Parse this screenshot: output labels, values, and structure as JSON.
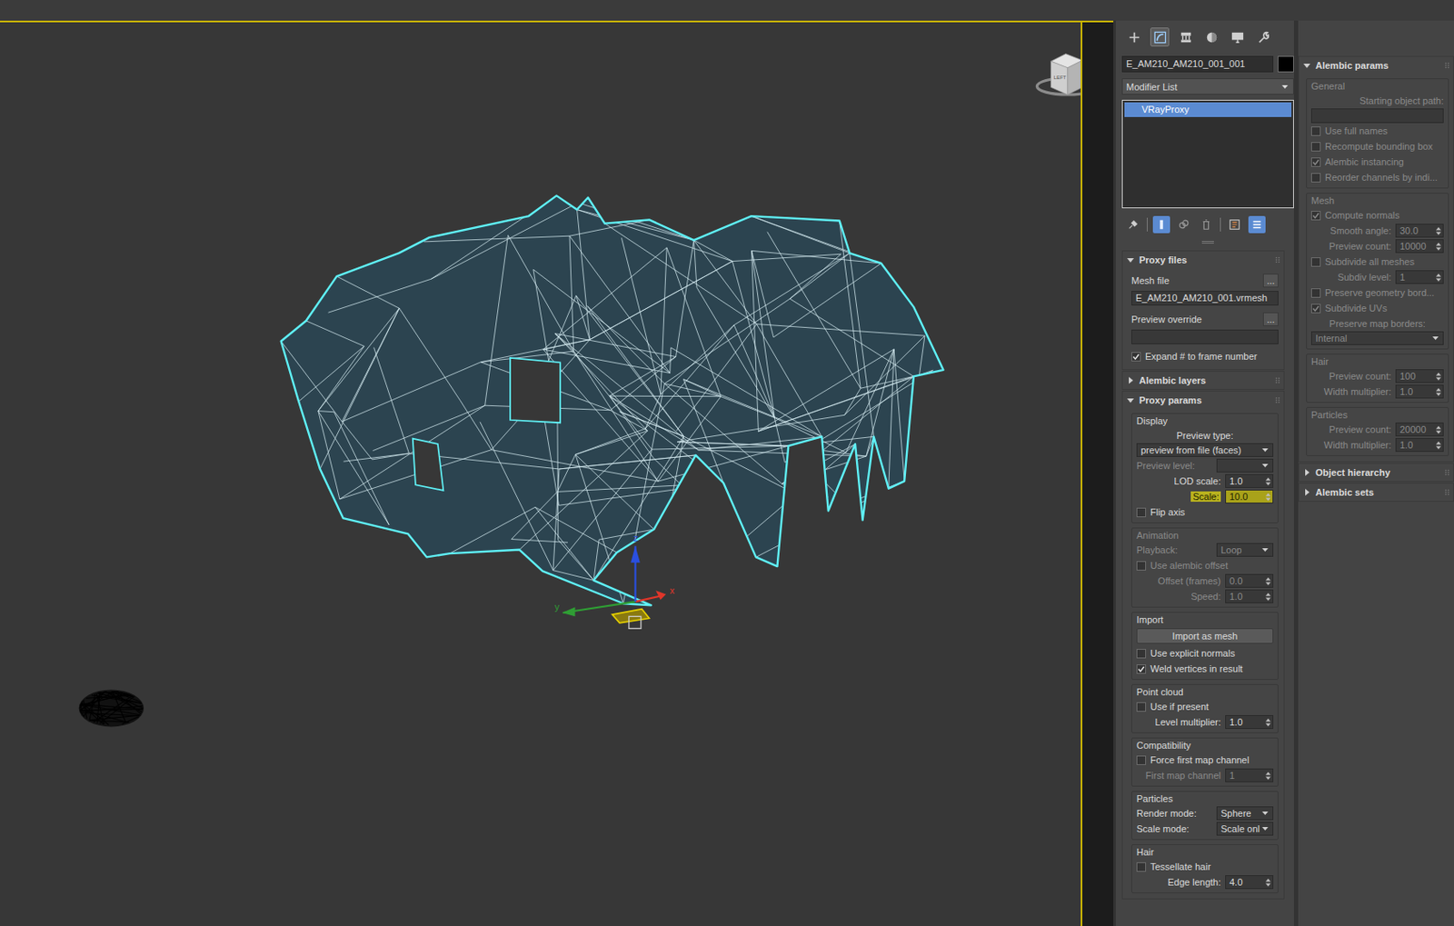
{
  "viewport": {
    "viewcube_label": "LEFT",
    "axes": [
      {
        "label": "x",
        "color": "#e0362a"
      },
      {
        "label": "y",
        "color": "#2f9e34"
      },
      {
        "label": "z",
        "color": "#2a4fe0"
      }
    ]
  },
  "command_tabs": [
    {
      "kind": "create",
      "selected": false
    },
    {
      "kind": "modify",
      "selected": true
    },
    {
      "kind": "hierarchy",
      "selected": false
    },
    {
      "kind": "motion",
      "selected": false
    },
    {
      "kind": "display",
      "selected": false
    },
    {
      "kind": "utilities",
      "selected": false
    }
  ],
  "object_name": "E_AM210_AM210_001_001",
  "modifier_list": "Modifier List",
  "stack": [
    {
      "label": "VRayProxy",
      "selected": true
    }
  ],
  "stack_tools": [
    {
      "kind": "pin",
      "selected": false
    },
    {
      "kind": "show-end-result",
      "selected": true
    },
    {
      "kind": "make-unique",
      "selected": false
    },
    {
      "kind": "remove",
      "selected": false
    },
    {
      "kind": "configure",
      "selected": false
    },
    {
      "kind": "sets",
      "selected": true
    }
  ],
  "rollouts": [
    {
      "title": "Proxy files",
      "expanded": true,
      "groups": [
        {
          "title": "",
          "boxed": false,
          "disabled": false,
          "items": [
            {
              "kind": "file",
              "label": "Mesh file",
              "button": "...",
              "value": "E_AM210_AM210_001.vrmesh"
            },
            {
              "kind": "file",
              "label": "Preview override",
              "button": "...",
              "value": ""
            },
            {
              "kind": "checkbox",
              "label": "Expand # to frame number",
              "checked": true,
              "disabled": false
            }
          ]
        }
      ]
    },
    {
      "title": "Alembic layers",
      "expanded": false,
      "groups": []
    },
    {
      "title": "Proxy params",
      "expanded": true,
      "groups": [
        {
          "title": "Display",
          "boxed": true,
          "disabled": false,
          "items": [
            {
              "kind": "stacked-dropdown",
              "label": "Preview type:",
              "value": "preview from file (faces)",
              "disabled": false
            },
            {
              "kind": "dropdown",
              "label": "Preview level:",
              "value": "",
              "disabled": true
            },
            {
              "kind": "spinner",
              "label": "LOD scale:",
              "value": "1.0",
              "disabled": false,
              "highlighted": false
            },
            {
              "kind": "spinner",
              "label": "Scale:",
              "value": "10.0",
              "disabled": false,
              "highlighted": true
            },
            {
              "kind": "checkbox",
              "label": "Flip axis",
              "checked": false,
              "disabled": false
            }
          ]
        },
        {
          "title": "Animation",
          "boxed": true,
          "disabled": true,
          "items": [
            {
              "kind": "dropdown",
              "label": "Playback:",
              "value": "Loop",
              "disabled": true
            },
            {
              "kind": "checkbox",
              "label": "Use alembic offset",
              "checked": false,
              "disabled": true
            },
            {
              "kind": "spinner",
              "label": "Offset (frames)",
              "value": "0.0",
              "disabled": true,
              "highlighted": false
            },
            {
              "kind": "spinner",
              "label": "Speed:",
              "value": "1.0",
              "disabled": true,
              "highlighted": false
            }
          ]
        },
        {
          "title": "Import",
          "boxed": true,
          "disabled": false,
          "items": [
            {
              "kind": "button",
              "label": "Import as mesh"
            },
            {
              "kind": "checkbox",
              "label": "Use explicit normals",
              "checked": false,
              "disabled": false
            },
            {
              "kind": "checkbox",
              "label": "Weld vertices in result",
              "checked": true,
              "disabled": false
            }
          ]
        },
        {
          "title": "Point cloud",
          "boxed": true,
          "disabled": false,
          "items": [
            {
              "kind": "checkbox",
              "label": "Use if present",
              "checked": false,
              "disabled": false
            },
            {
              "kind": "spinner",
              "label": "Level multiplier:",
              "value": "1.0",
              "disabled": false,
              "highlighted": false
            }
          ]
        },
        {
          "title": "Compatibility",
          "boxed": true,
          "disabled": false,
          "items": [
            {
              "kind": "checkbox",
              "label": "Force first map channel",
              "checked": false,
              "disabled": false
            },
            {
              "kind": "spinner",
              "label": "First map channel",
              "value": "1",
              "disabled": true,
              "highlighted": false
            }
          ]
        },
        {
          "title": "Particles",
          "boxed": true,
          "disabled": false,
          "items": [
            {
              "kind": "dropdown",
              "label": "Render mode:",
              "value": "Sphere",
              "disabled": false
            },
            {
              "kind": "dropdown",
              "label": "Scale mode:",
              "value": "Scale onl",
              "disabled": false
            }
          ]
        },
        {
          "title": "Hair",
          "boxed": true,
          "disabled": false,
          "items": [
            {
              "kind": "checkbox",
              "label": "Tessellate hair",
              "checked": false,
              "disabled": false
            },
            {
              "kind": "spinner",
              "label": "Edge length:",
              "value": "4.0",
              "disabled": false,
              "highlighted": false
            }
          ]
        }
      ]
    }
  ],
  "side_rollouts": [
    {
      "title": "Alembic params",
      "expanded": true,
      "groups": [
        {
          "title": "General",
          "boxed": true,
          "disabled": true,
          "items": [
            {
              "kind": "stacked-field",
              "label": "Starting object path:",
              "value": "",
              "disabled": true
            },
            {
              "kind": "checkbox",
              "label": "Use full names",
              "checked": false,
              "disabled": true
            },
            {
              "kind": "checkbox",
              "label": "Recompute bounding box",
              "checked": false,
              "disabled": true
            },
            {
              "kind": "checkbox",
              "label": "Alembic instancing",
              "checked": true,
              "disabled": true
            },
            {
              "kind": "checkbox",
              "label": "Reorder channels by indi...",
              "checked": false,
              "disabled": true
            }
          ]
        },
        {
          "title": "Mesh",
          "boxed": true,
          "disabled": true,
          "items": [
            {
              "kind": "checkbox",
              "label": "Compute normals",
              "checked": true,
              "disabled": true
            },
            {
              "kind": "spinner",
              "label": "Smooth angle:",
              "value": "30.0",
              "disabled": true,
              "highlighted": false
            },
            {
              "kind": "spinner",
              "label": "Preview count:",
              "value": "10000",
              "disabled": true,
              "highlighted": false
            },
            {
              "kind": "checkbox",
              "label": "Subdivide all meshes",
              "checked": false,
              "disabled": true
            },
            {
              "kind": "spinner",
              "label": "Subdiv level:",
              "value": "1",
              "disabled": true,
              "highlighted": false
            },
            {
              "kind": "checkbox",
              "label": "Preserve geometry bord...",
              "checked": false,
              "disabled": true
            },
            {
              "kind": "checkbox",
              "label": "Subdivide UVs",
              "checked": true,
              "disabled": true
            },
            {
              "kind": "stacked-dropdown",
              "label": "Preserve map borders:",
              "value": "Internal",
              "disabled": true
            }
          ]
        },
        {
          "title": "Hair",
          "boxed": true,
          "disabled": true,
          "items": [
            {
              "kind": "spinner",
              "label": "Preview count:",
              "value": "100",
              "disabled": true,
              "highlighted": false
            },
            {
              "kind": "spinner",
              "label": "Width multiplier:",
              "value": "1.0",
              "disabled": true,
              "highlighted": false
            }
          ]
        },
        {
          "title": "Particles",
          "boxed": true,
          "disabled": true,
          "items": [
            {
              "kind": "spinner",
              "label": "Preview count:",
              "value": "20000",
              "disabled": true,
              "highlighted": false
            },
            {
              "kind": "spinner",
              "label": "Width multiplier:",
              "value": "1.0",
              "disabled": true,
              "highlighted": false
            }
          ]
        }
      ]
    },
    {
      "title": "Object hierarchy",
      "expanded": false,
      "groups": []
    },
    {
      "title": "Alembic sets",
      "expanded": false,
      "groups": []
    }
  ]
}
